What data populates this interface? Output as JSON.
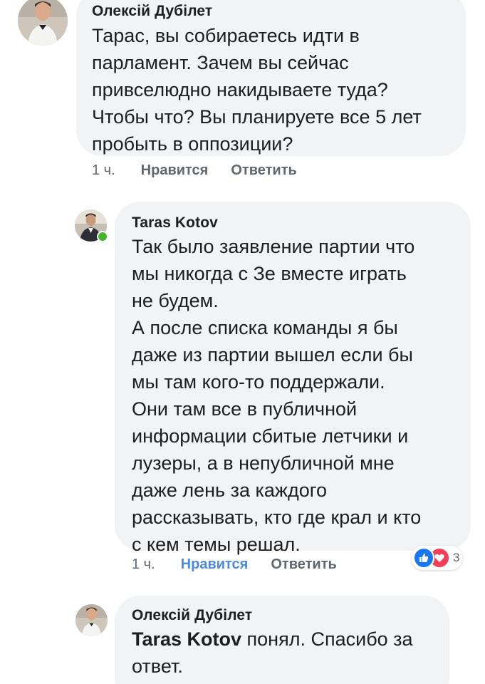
{
  "comments": [
    {
      "author": "Олексій Дубілет",
      "text": "Тарас, вы собираетесь идти в\nпарламент. Зачем вы сейчас\nпривселюдно накидываете туда?\nЧтобы что? Вы планируете все 5 лет\nпробыть в оппозиции?",
      "time": "1 ч.",
      "like_label": "Нравится",
      "reply_label": "Ответить"
    },
    {
      "author": "Taras Kotov",
      "text": "Так было заявление партии что\nмы никогда с Зе вместе играть\nне будем.\nА после списка команды я бы\nдаже из партии вышел если бы\nмы там кого-то поддержали.\nОни там все в публичной\nинформации сбитые летчики и\nлузеры, а в непубличной мне\nдаже лень за каждого\nрассказывать, кто где крал и кто\nс кем темы решал.",
      "time": "1 ч.",
      "like_label": "Нравится",
      "reply_label": "Ответить",
      "liked": true,
      "reactions": {
        "count": "3",
        "types": [
          "like-icon",
          "love-icon"
        ],
        "like_color": "#1877f2",
        "love_color": "#f33e58"
      }
    },
    {
      "author": "Олексій Дубілет",
      "mention": "Taras Kotov",
      "text": " понял. Спасибо за\nответ."
    }
  ],
  "colors": {
    "bubble_bg": "#f2f3f5",
    "liked_link": "#4a8be0",
    "meta_text": "#606770",
    "online_dot": "#42b72a"
  }
}
